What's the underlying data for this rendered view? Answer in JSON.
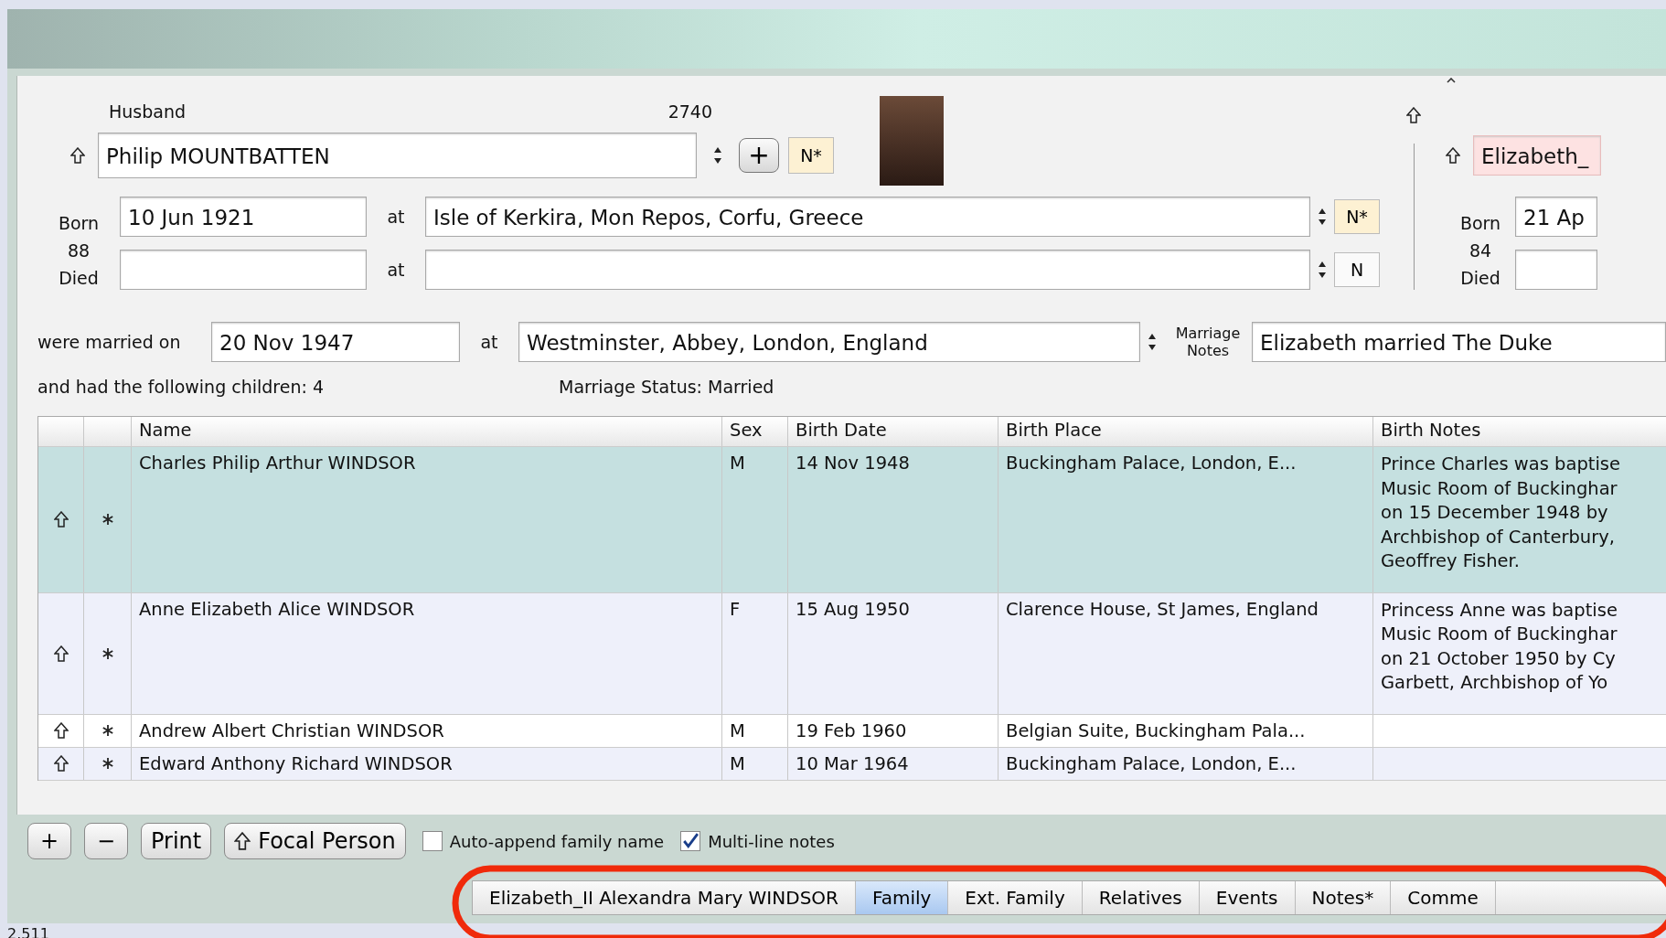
{
  "husband": {
    "label": "Husband",
    "record_number": "2740",
    "name": "Philip MOUNTBATTEN",
    "add_button": "+",
    "notes_button": {
      "label": "N*",
      "highlighted": true
    },
    "born_label": "Born",
    "age": "88",
    "died_label": "Died",
    "born": {
      "date": "10 Jun 1921",
      "at": "at",
      "place": "Isle of Kerkira, Mon Repos, Corfu, Greece",
      "notes_button": {
        "label": "N*",
        "highlighted": true
      }
    },
    "died": {
      "at": "at",
      "notes_button": {
        "label": "N",
        "highlighted": false
      }
    }
  },
  "wife": {
    "name": "Elizabeth_",
    "born_label": "Born",
    "age": "84",
    "died_label": "Died",
    "born_date": "21 Ap"
  },
  "marriage": {
    "label": "were married on",
    "date": "20 Nov 1947",
    "at": "at",
    "place": "Westminster, Abbey, London, England",
    "notes_label": "Marriage Notes",
    "notes": "Elizabeth married The Duke"
  },
  "children_summary": "and had the following children: 4",
  "marriage_status": "Marriage Status: Married",
  "table": {
    "columns": [
      "Name",
      "Sex",
      "Birth Date",
      "Birth Place",
      "Birth Notes"
    ],
    "rows": [
      {
        "name": "Charles Philip Arthur WINDSOR",
        "sex": "M",
        "birth_date": "14 Nov 1948",
        "birth_place": "Buckingham Palace, London, E...",
        "birth_notes": [
          "Prince Charles was baptise",
          "Music Room of Buckinghar",
          "on 15 December 1948 by",
          "Archbishop of Canterbury,",
          "Geoffrey Fisher."
        ],
        "selected": true
      },
      {
        "name": "Anne Elizabeth Alice WINDSOR",
        "sex": "F",
        "birth_date": "15 Aug 1950",
        "birth_place": "Clarence House, St James, England",
        "birth_notes": [
          "Princess Anne was baptise",
          "Music Room of Buckinghar",
          "on 21 October 1950 by Cy",
          "Garbett, Archbishop of Yo"
        ],
        "selected": false
      },
      {
        "name": "Andrew Albert Christian WINDSOR",
        "sex": "M",
        "birth_date": "19 Feb 1960",
        "birth_place": "Belgian Suite, Buckingham Pala...",
        "birth_notes": [],
        "selected": false
      },
      {
        "name": "Edward Anthony Richard WINDSOR",
        "sex": "M",
        "birth_date": "10 Mar 1964",
        "birth_place": "Buckingham Palace, London, E...",
        "birth_notes": [],
        "selected": false
      }
    ]
  },
  "bottom_buttons": [
    {
      "label": "+",
      "kind": "plain"
    },
    {
      "label": "−",
      "kind": "plain"
    },
    {
      "label": "Print",
      "kind": "plain"
    },
    {
      "label": "Focal Person",
      "kind": "focal"
    }
  ],
  "checkboxes": [
    {
      "label": "Auto-append family name",
      "checked": false
    },
    {
      "label": "Multi-line notes",
      "checked": true
    }
  ],
  "tabs": [
    {
      "label": "Elizabeth_II Alexandra Mary WINDSOR",
      "selected": false
    },
    {
      "label": "Family",
      "selected": true
    },
    {
      "label": "Ext. Family",
      "selected": false
    },
    {
      "label": "Relatives",
      "selected": false
    },
    {
      "label": "Events",
      "selected": false
    },
    {
      "label": "Notes*",
      "selected": false
    },
    {
      "label": "Comme",
      "selected": false
    }
  ],
  "version": "2.511"
}
